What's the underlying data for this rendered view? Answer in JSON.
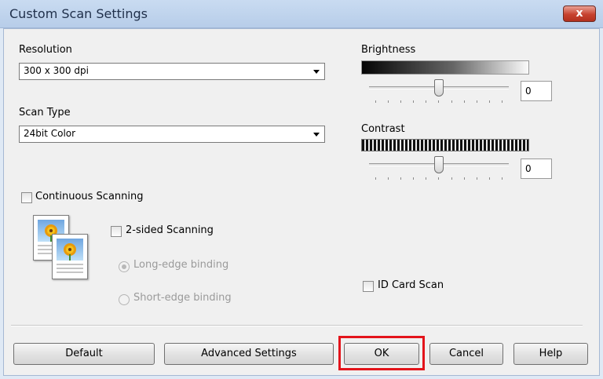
{
  "window": {
    "title": "Custom Scan Settings",
    "close_label": "x"
  },
  "resolution": {
    "label": "Resolution",
    "value": "300 x 300 dpi"
  },
  "scan_type": {
    "label": "Scan Type",
    "value": "24bit Color"
  },
  "brightness": {
    "label": "Brightness",
    "value": "0",
    "slider_level": 0.5
  },
  "contrast": {
    "label": "Contrast",
    "value": "0",
    "slider_level": 0.5
  },
  "options": {
    "continuous_label": "Continuous Scanning",
    "two_sided_label": "2-sided Scanning",
    "long_edge_label": "Long-edge binding",
    "short_edge_label": "Short-edge binding",
    "id_card_label": "ID Card Scan"
  },
  "buttons": {
    "default": "Default",
    "advanced": "Advanced Settings",
    "ok": "OK",
    "cancel": "Cancel",
    "help": "Help"
  },
  "colors": {
    "highlight": "#e3141b",
    "title_bar": "#c9dbf1"
  }
}
